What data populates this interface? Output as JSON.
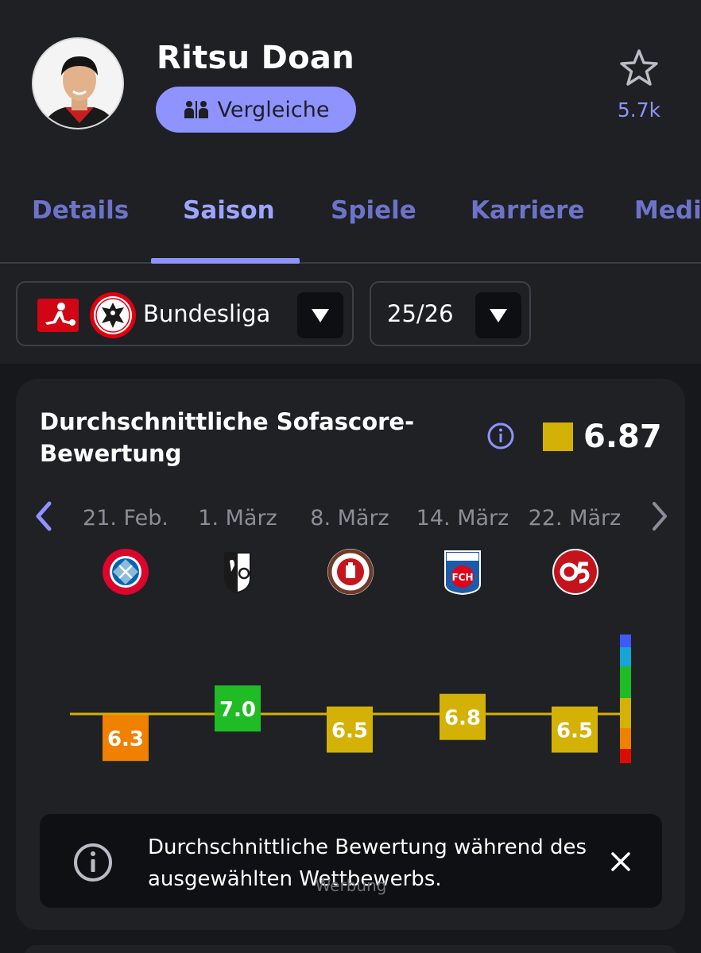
{
  "player": {
    "name": "Ritsu Doan",
    "compare_label": "Vergleiche",
    "favorites_count": "5.7k"
  },
  "tabs": [
    {
      "label": "Details"
    },
    {
      "label": "Saison",
      "active": true
    },
    {
      "label": "Spiele"
    },
    {
      "label": "Karriere"
    },
    {
      "label": "Medi"
    }
  ],
  "filters": {
    "competition": "Bundesliga",
    "season": "25/26"
  },
  "rating_card": {
    "title": "Durchschnittliche Sofascore-Bewertung",
    "average": "6.87",
    "average_color": "#d4b106",
    "matches": [
      {
        "date": "21. Feb.",
        "opponent_icon": "fc-bayern-crest",
        "rating": 6.3,
        "rating_label": "6.3",
        "color": "#f08000"
      },
      {
        "date": "1. März",
        "opponent_icon": "sc-freiburg-crest",
        "rating": 7.0,
        "rating_label": "7.0",
        "color": "#1fbc26"
      },
      {
        "date": "8. März",
        "opponent_icon": "fc-st-pauli-crest",
        "rating": 6.5,
        "rating_label": "6.5",
        "color": "#d4b106"
      },
      {
        "date": "14. März",
        "opponent_icon": "heidenheim-crest",
        "rating": 6.8,
        "rating_label": "6.8",
        "color": "#d4b106"
      },
      {
        "date": "22. März",
        "opponent_icon": "mainz-05-crest",
        "rating": 6.5,
        "rating_label": "6.5",
        "color": "#d4b106"
      }
    ],
    "scale_colors": [
      "#3d5aff",
      "#16a4d4",
      "#1fbc26",
      "#d4b106",
      "#f08000",
      "#dc0c00"
    ]
  },
  "toast": {
    "text": "Durchschnittliche Bewertung während des ausgewählten Wettbewerbs.",
    "ad_label": "Werbung"
  },
  "colors": {
    "accent": "#8f93ff",
    "background": "#1e2024"
  }
}
